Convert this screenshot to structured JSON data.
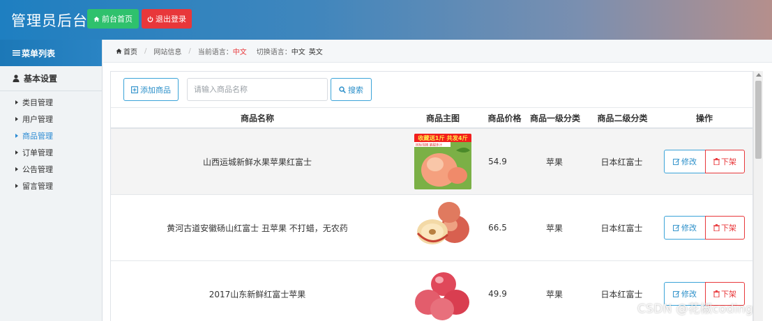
{
  "header": {
    "title": "管理员后台",
    "home_button": "前台首页",
    "logout_button": "退出登录"
  },
  "sidebar": {
    "heading": "菜单列表",
    "group": "基本设置",
    "items": [
      {
        "label": "类目管理",
        "active": false
      },
      {
        "label": "用户管理",
        "active": false
      },
      {
        "label": "商品管理",
        "active": true
      },
      {
        "label": "订单管理",
        "active": false
      },
      {
        "label": "公告管理",
        "active": false
      },
      {
        "label": "留言管理",
        "active": false
      }
    ]
  },
  "breadcrumb": {
    "home": "首页",
    "site_info": "网站信息",
    "current_lang_label": "当前语言：",
    "current_lang_value": "中文",
    "switch_lang_label": "切换语言：",
    "lang_zh": "中文",
    "lang_en": "英文"
  },
  "toolbar": {
    "add_button": "添加商品",
    "search_placeholder": "请输入商品名称",
    "search_value": "",
    "search_button": "搜索"
  },
  "table": {
    "columns": [
      "商品名称",
      "商品主图",
      "商品价格",
      "商品一级分类",
      "商品二级分类",
      "操作"
    ],
    "rows": [
      {
        "name": "山西运城新鲜水果苹果红富士",
        "price": "54.9",
        "cat1": "苹果",
        "cat2": "日本红富士",
        "image": "peach-apple-banner"
      },
      {
        "name": "黄河古道安徽砀山红富士 丑苹果 不打蜡，无农药",
        "price": "66.5",
        "cat1": "苹果",
        "cat2": "日本红富士",
        "image": "cut-apple"
      },
      {
        "name": "2017山东新鲜红富士苹果",
        "price": "49.9",
        "cat1": "苹果",
        "cat2": "日本红富士",
        "image": "red-apples"
      }
    ],
    "edit_label": "修改",
    "delist_label": "下架"
  },
  "thumb_banner": {
    "line1": "收藏送1斤 共发4斤",
    "line2": "树标现摘 脆甜多汁"
  },
  "watermark": "CSDN @花椒coding",
  "colors": {
    "accent": "#2b8fc9",
    "danger": "#e8373a",
    "success": "#2fc16d"
  }
}
